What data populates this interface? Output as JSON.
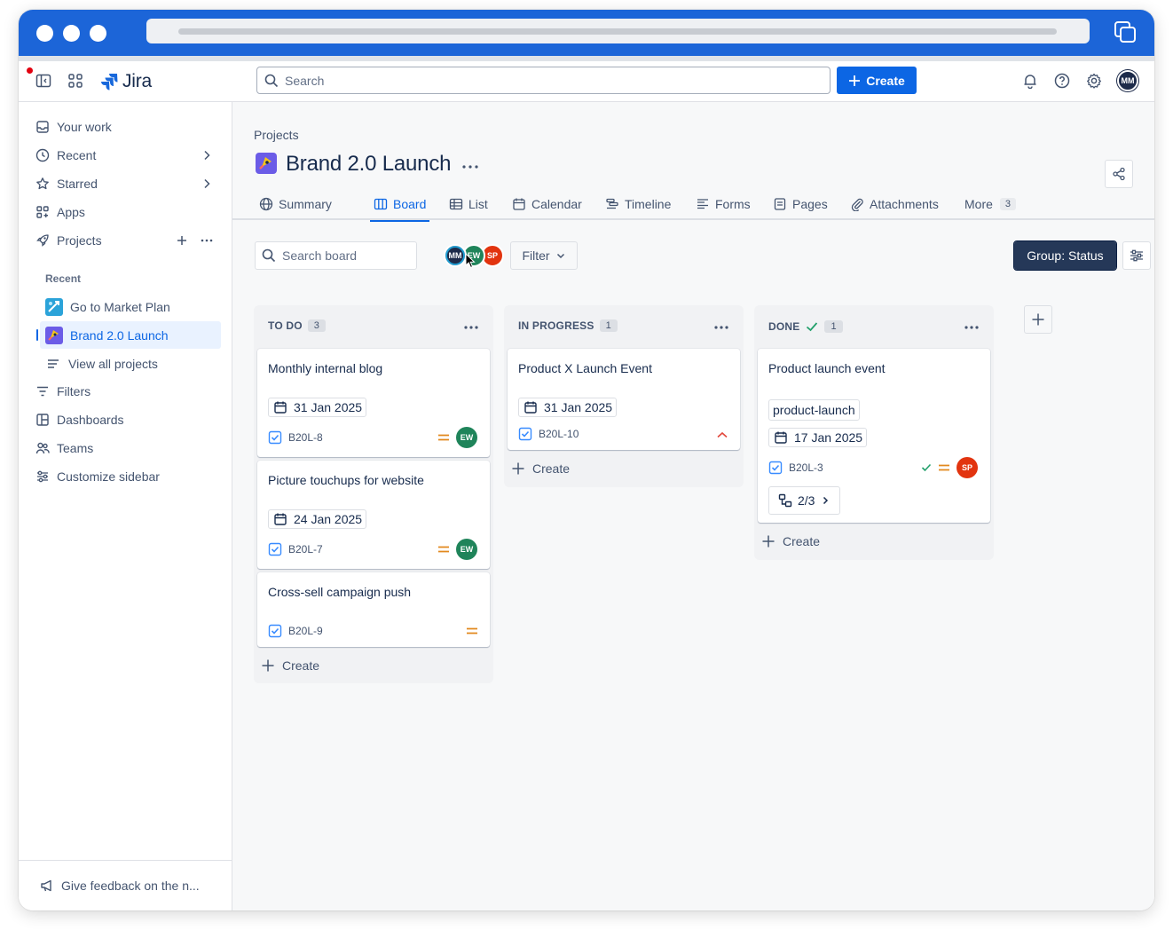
{
  "app": {
    "name": "Jira"
  },
  "topbar": {
    "search_placeholder": "Search",
    "create_label": "Create",
    "avatar_initials": "MM"
  },
  "sidebar": {
    "your_work": "Your work",
    "recent": "Recent",
    "starred": "Starred",
    "apps": "Apps",
    "projects": "Projects",
    "recent_heading": "Recent",
    "recent_projects": [
      "Go to Market Plan",
      "Brand 2.0 Launch"
    ],
    "view_all": "View all projects",
    "filters": "Filters",
    "dashboards": "Dashboards",
    "teams": "Teams",
    "customize": "Customize sidebar",
    "feedback": "Give feedback on the n..."
  },
  "project": {
    "breadcrumb": "Projects",
    "title": "Brand 2.0 Launch",
    "tabs": [
      "Summary",
      "Board",
      "List",
      "Calendar",
      "Timeline",
      "Forms",
      "Pages",
      "Attachments",
      "More"
    ],
    "more_count": "3",
    "active_tab": "Board"
  },
  "board": {
    "search_placeholder": "Search board",
    "avatars": [
      "MM",
      "EW",
      "SP"
    ],
    "filter_label": "Filter",
    "group_label": "Group: Status",
    "create_label": "Create",
    "columns": [
      {
        "title": "TO DO",
        "count": "3",
        "cards": [
          {
            "title": "Monthly internal blog",
            "date": "31 Jan 2025",
            "key": "B20L-8",
            "assignee": "EW"
          },
          {
            "title": "Picture touchups for website",
            "date": "24 Jan 2025",
            "key": "B20L-7",
            "assignee": "EW"
          },
          {
            "title": "Cross-sell campaign push",
            "key": "B20L-9"
          }
        ]
      },
      {
        "title": "IN PROGRESS",
        "count": "1",
        "cards": [
          {
            "title": "Product X Launch Event",
            "date": "31 Jan 2025",
            "key": "B20L-10"
          }
        ]
      },
      {
        "title": "DONE",
        "count": "1",
        "cards": [
          {
            "title": "Product launch event",
            "label": "product-launch",
            "date": "17 Jan 2025",
            "key": "B20L-3",
            "assignee": "SP",
            "children": "2/3"
          }
        ]
      }
    ]
  },
  "colors": {
    "primary": "#0c66e4",
    "chrome": "#1c65d8",
    "avatar_mm": "#1d2b4a",
    "avatar_ew": "#1f845a",
    "avatar_sp": "#e2340f",
    "priority_medium": "#e2891d",
    "priority_high": "#e2483d",
    "done_check": "#22a06b"
  },
  "icons": {
    "priority_medium": "equals-icon",
    "priority_high": "chevron-up-icon",
    "issue_type": "task-checkbox-icon"
  }
}
